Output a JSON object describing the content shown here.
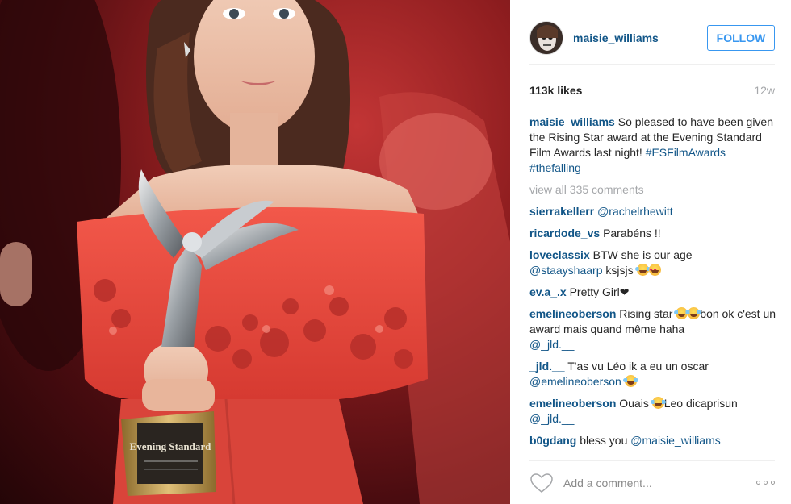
{
  "post": {
    "username": "maisie_williams",
    "follow_label": "FOLLOW",
    "likes": "113k likes",
    "time_ago": "12w",
    "caption": {
      "user": "maisie_williams",
      "text": "So pleased to have been given the Rising Star award at the Evening Standard Film Awards last night!",
      "hashtag1": "#ESFilmAwards",
      "hashtag2": "#thefalling"
    },
    "view_all": "view all 335 comments",
    "add_comment_placeholder": "Add a comment...",
    "award_plaque_text": "Evening Standard"
  },
  "comments": [
    {
      "user": "sierrakellerr",
      "text": "",
      "mention": "@rachelrhewitt"
    },
    {
      "user": "ricardode_vs",
      "text": "Parabéns !!"
    },
    {
      "user": "loveclassix",
      "text": "BTW she is our age",
      "mention": "@staayshaarp",
      "tail": "ksjsjs"
    },
    {
      "user": "ev.a_.x",
      "text": "Pretty Girl",
      "heart": "❤"
    },
    {
      "user": "emelineoberson",
      "text": "Rising star",
      "text2": "bon ok c'est un award mais quand même haha",
      "mention": "@_jld.__"
    },
    {
      "user": "_jld.__",
      "text": "T'as vu Léo ik a eu un oscar",
      "mention": "@emelineoberson"
    },
    {
      "user": "emelineoberson",
      "text": "Ouais",
      "text2": "Leo dicaprisun",
      "mention": "@_jld.__"
    },
    {
      "user": "b0gdang",
      "text": "bless you",
      "mention": "@maisie_williams"
    }
  ],
  "colors": {
    "link": "#125688",
    "follow": "#3897f0",
    "muted": "#a5a7aa",
    "dress": "#e8473e"
  },
  "icons": [
    "heart-icon",
    "more-options-icon",
    "cry-laugh-emoji",
    "heart-eyes-emoji"
  ]
}
